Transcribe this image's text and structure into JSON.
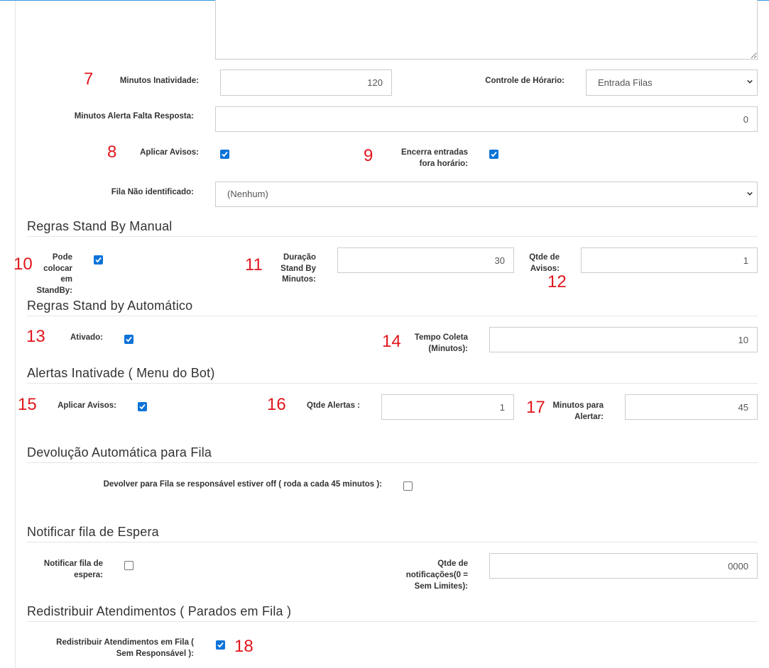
{
  "form": {
    "minutos_inatividade": {
      "label": "Minutos Inatividade:",
      "value": "120"
    },
    "controle_horario": {
      "label": "Controle de Hórario:",
      "selected": "Entrada Filas"
    },
    "minutos_alerta": {
      "label": "Minutos Alerta Falta Resposta:",
      "value": "0"
    },
    "aplicar_avisos": {
      "label": "Aplicar Avisos:",
      "checked": true
    },
    "encerra_entradas": {
      "label_line1": "Encerra entradas",
      "label_line2": "fora horário:",
      "checked": true
    },
    "fila_nao_identificado": {
      "label": "Fila Não identificado:",
      "selected": "(Nenhum)"
    }
  },
  "standby_manual": {
    "title": "Regras Stand By Manual",
    "pode_colocar": {
      "label_lines": [
        "Pode",
        "colocar",
        "em",
        "StandBy:"
      ],
      "checked": true
    },
    "duracao": {
      "label_lines": [
        "Duração",
        "Stand By",
        "Minutos:"
      ],
      "value": "30"
    },
    "qtde_avisos": {
      "label_lines": [
        "Qtde de",
        "Avisos:"
      ],
      "value": "1"
    }
  },
  "standby_auto": {
    "title": "Regras Stand by Automático",
    "ativado": {
      "label": "Ativado:",
      "checked": true
    },
    "tempo_coleta": {
      "label_line1": "Tempo Coleta",
      "label_line2": "(Minutos):",
      "value": "10"
    }
  },
  "alertas": {
    "title": "Alertas Inativade ( Menu do Bot)",
    "aplicar_avisos": {
      "label": "Aplicar Avisos:",
      "checked": true
    },
    "qtde_alertas": {
      "label": "Qtde Alertas :",
      "value": "1"
    },
    "minutos_alertar": {
      "label_line1": "Minutos para",
      "label_line2": "Alertar:",
      "value": "45"
    }
  },
  "devolucao": {
    "title": "Devolução Automática para Fila",
    "devolver": {
      "label": "Devolver para Fila se responsável estiver off ( roda a cada 45 minutos ):",
      "checked": false
    }
  },
  "notificar": {
    "title": "Notificar fila de Espera",
    "notificar_fila": {
      "label_line1": "Notificar fila de",
      "label_line2": "espera:",
      "checked": false
    },
    "qtde_notificacoes": {
      "label_lines": [
        "Qtde de",
        "notificações(0 =",
        "Sem Limites):"
      ],
      "value": "0000"
    }
  },
  "redistribuir": {
    "title": "Redistribuir Atendimentos ( Parados em Fila )",
    "redistribuir_fila": {
      "label_line1": "Redistribuir Atendimentos em Fila (",
      "label_line2": "Sem Responsável ):",
      "checked": true
    }
  },
  "annotations": [
    "7",
    "8",
    "9",
    "10",
    "11",
    "12",
    "13",
    "14",
    "15",
    "16",
    "17",
    "18"
  ],
  "colors": {
    "annotation": "#e0161d",
    "checkbox_checked": "#0b73d8",
    "top_border": "#3399dd"
  },
  "icons": {
    "select_caret": "chevron-down-icon",
    "checkmark": "check-icon"
  }
}
